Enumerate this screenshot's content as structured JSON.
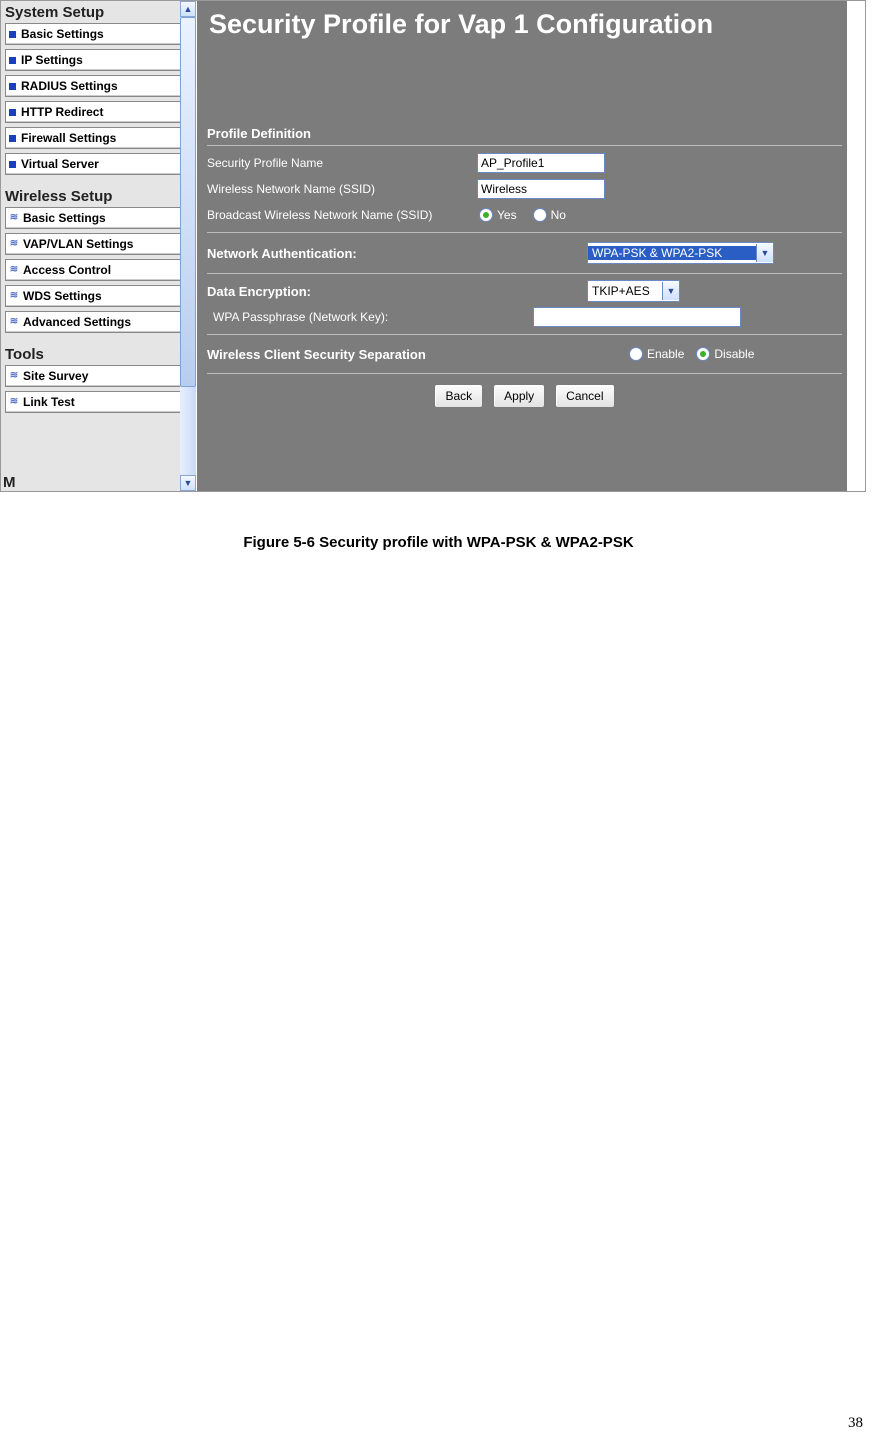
{
  "sidebar": {
    "section1": {
      "title": "System Setup",
      "items": [
        "Basic Settings",
        "IP Settings",
        "RADIUS Settings",
        "HTTP Redirect",
        "Firewall Settings",
        "Virtual Server"
      ]
    },
    "section2": {
      "title": "Wireless Setup",
      "items": [
        "Basic Settings",
        "VAP/VLAN Settings",
        "Access Control",
        "WDS Settings",
        "Advanced Settings"
      ]
    },
    "section3": {
      "title": "Tools",
      "items": [
        "Site Survey",
        "Link Test"
      ]
    }
  },
  "content": {
    "title": "Security Profile for Vap 1 Configuration",
    "profile_def": {
      "heading": "Profile Definition",
      "name_label": "Security Profile Name",
      "name_value": "AP_Profile1",
      "ssid_label": "Wireless Network Name (SSID)",
      "ssid_value": "Wireless",
      "bcast_label": "Broadcast Wireless Network Name (SSID)",
      "yes": "Yes",
      "no": "No"
    },
    "net_auth": {
      "heading": "Network Authentication:",
      "value": "WPA-PSK & WPA2-PSK"
    },
    "data_enc": {
      "heading": "Data Encryption:",
      "value": "TKIP+AES",
      "pass_label": "WPA Passphrase (Network Key):",
      "pass_value": ""
    },
    "sep": {
      "heading": "Wireless Client Security Separation",
      "enable": "Enable",
      "disable": "Disable"
    },
    "buttons": {
      "back": "Back",
      "apply": "Apply",
      "cancel": "Cancel"
    }
  },
  "caption": "Figure 5-6 Security profile with WPA-PSK & WPA2-PSK",
  "page_number": "38"
}
